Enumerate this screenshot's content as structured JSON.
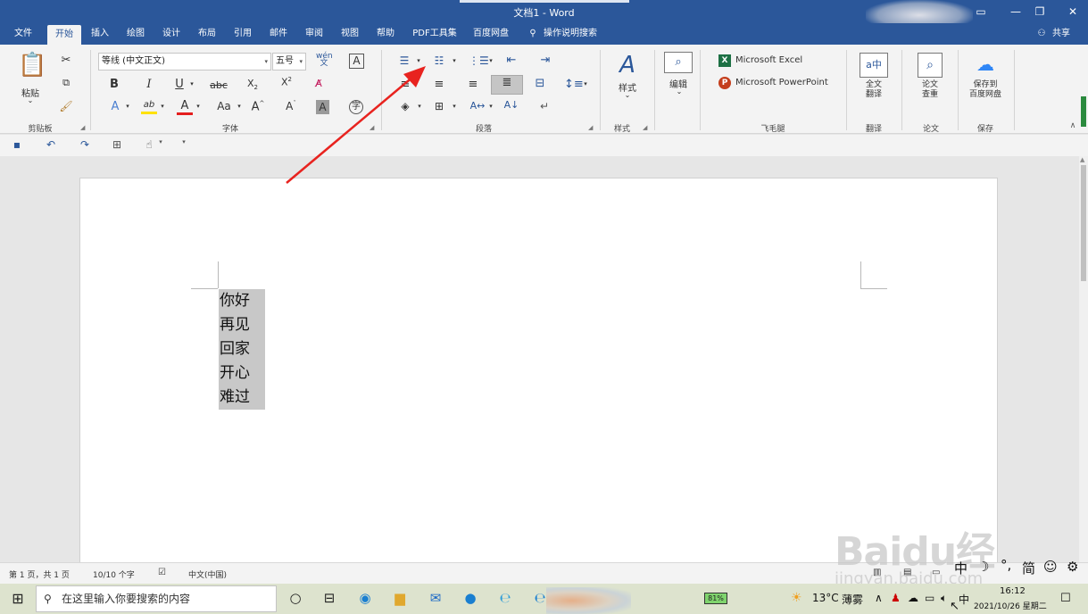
{
  "window": {
    "title": "文档1  -  Word",
    "share": "共享"
  },
  "tabs": [
    "文件",
    "开始",
    "插入",
    "绘图",
    "设计",
    "布局",
    "引用",
    "邮件",
    "审阅",
    "视图",
    "帮助",
    "PDF工具集",
    "百度网盘",
    "操作说明搜索"
  ],
  "ribbon": {
    "clipboard": {
      "paste": "粘贴",
      "label": "剪贴板"
    },
    "font": {
      "name": "等线 (中文正文)",
      "size": "五号",
      "label": "字体"
    },
    "paragraph": {
      "label": "段落"
    },
    "styles": {
      "styles": "样式",
      "label": "样式"
    },
    "editing": {
      "label": "编辑"
    },
    "feimaotui": {
      "excel": "Microsoft Excel",
      "ppt": "Microsoft PowerPoint",
      "label": "飞毛腿"
    },
    "translate": {
      "button": "全文\n翻译",
      "label": "翻译"
    },
    "paper": {
      "button": "论文\n查重",
      "label": "论文"
    },
    "save": {
      "button": "保存到\n百度网盘",
      "label": "保存"
    }
  },
  "document": {
    "lines": [
      "你好",
      "再见",
      "回家",
      "开心",
      "难过"
    ]
  },
  "status": {
    "page": "第 1 页，共 1 页",
    "words": "10/10 个字",
    "language": "中文(中国)"
  },
  "ime": {
    "mode": "中",
    "simplified": "简",
    "punct": "°,"
  },
  "taskbar": {
    "search_placeholder": "在这里输入你要搜索的内容",
    "battery": "81%",
    "weather_temp": "13°C",
    "weather_desc": "薄雾",
    "input_lang": "中",
    "time": "16:12",
    "date": "2021/10/26 星期二"
  },
  "watermark": {
    "brand": "Baidu经验",
    "url": "jingyan.baidu.com"
  },
  "colors": {
    "word_blue": "#2b579a",
    "arrow_red": "#e8231f",
    "font_red": "#e41e1e",
    "highlight_yellow": "#ffe100"
  }
}
